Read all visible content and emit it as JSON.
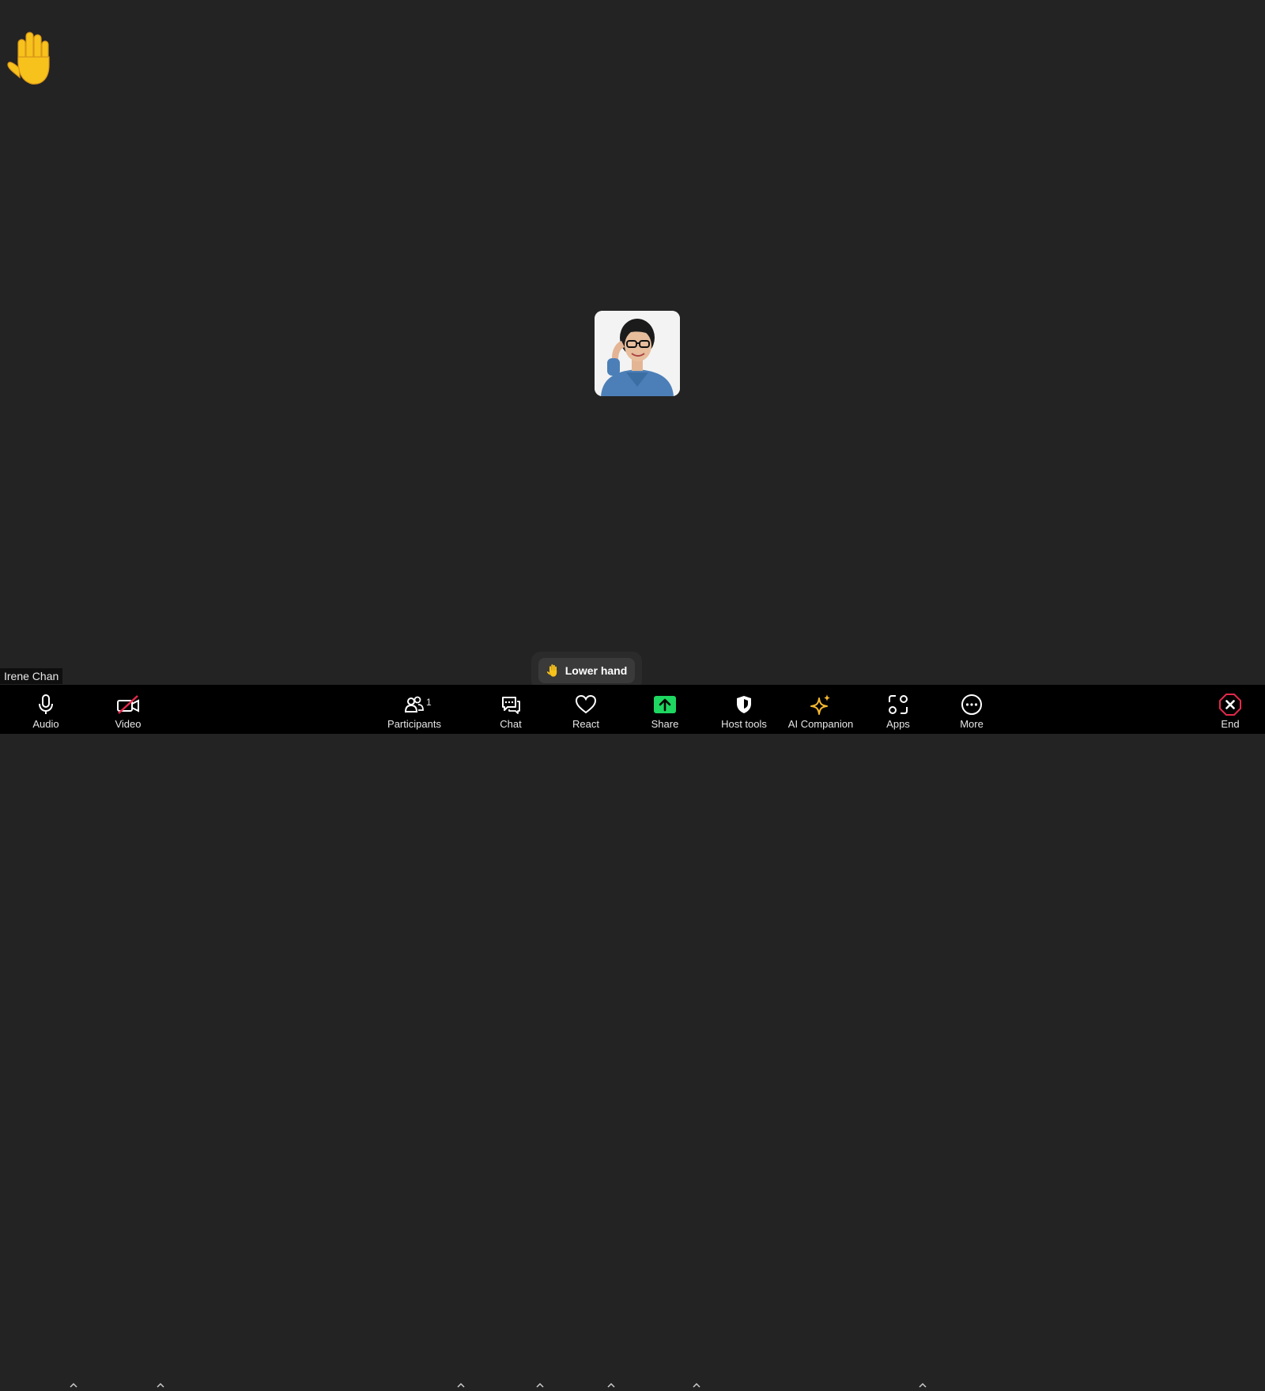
{
  "participant": {
    "name": "Irene Chan"
  },
  "raise_hand": {
    "icon": "raised-hand-icon",
    "lower_label": "Lower hand"
  },
  "toolbar": {
    "audio": {
      "label": "Audio",
      "icon": "microphone-icon"
    },
    "video": {
      "label": "Video",
      "icon": "video-off-icon"
    },
    "participants": {
      "label": "Participants",
      "count": "1",
      "icon": "participants-icon"
    },
    "chat": {
      "label": "Chat",
      "icon": "chat-icon"
    },
    "react": {
      "label": "React",
      "icon": "heart-icon"
    },
    "share": {
      "label": "Share",
      "icon": "share-screen-icon",
      "color": "#1ed760"
    },
    "host_tools": {
      "label": "Host tools",
      "icon": "shield-icon"
    },
    "ai_companion": {
      "label": "AI Companion",
      "icon": "sparkle-icon",
      "color": "#f5b82e"
    },
    "apps": {
      "label": "Apps",
      "icon": "apps-icon"
    },
    "more": {
      "label": "More",
      "icon": "more-icon"
    },
    "end": {
      "label": "End",
      "icon": "end-icon",
      "color": "#e5294b"
    }
  },
  "colors": {
    "background": "#232323",
    "toolbar": "#000000",
    "hand": "#f7c21b"
  }
}
